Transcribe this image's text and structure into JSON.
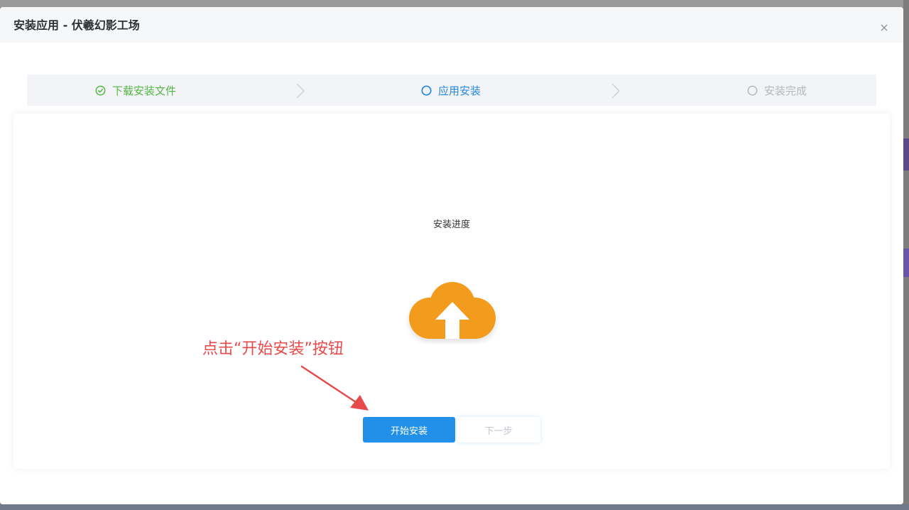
{
  "dialog": {
    "title": "安装应用 - 伏羲幻影工场",
    "close_icon": "close-icon"
  },
  "steps": [
    {
      "label": "下载安装文件",
      "status": "done",
      "color": "#55b545",
      "icon": "check-circle-icon"
    },
    {
      "label": "应用安装",
      "status": "active",
      "color": "#2388e2",
      "icon": "circle-icon"
    },
    {
      "label": "安装完成",
      "status": "pending",
      "color": "#b4b6bb",
      "icon": "circle-icon"
    }
  ],
  "main": {
    "progress_label": "安装进度",
    "upload_icon": "cloud-upload-icon",
    "icon_color": "#f29b1c",
    "annotation": "点击“开始安装”按钮",
    "annotation_color": "#e84a4a",
    "start_button_label": "开始安装",
    "next_button_label": "下一步",
    "primary_color": "#2290e8"
  }
}
